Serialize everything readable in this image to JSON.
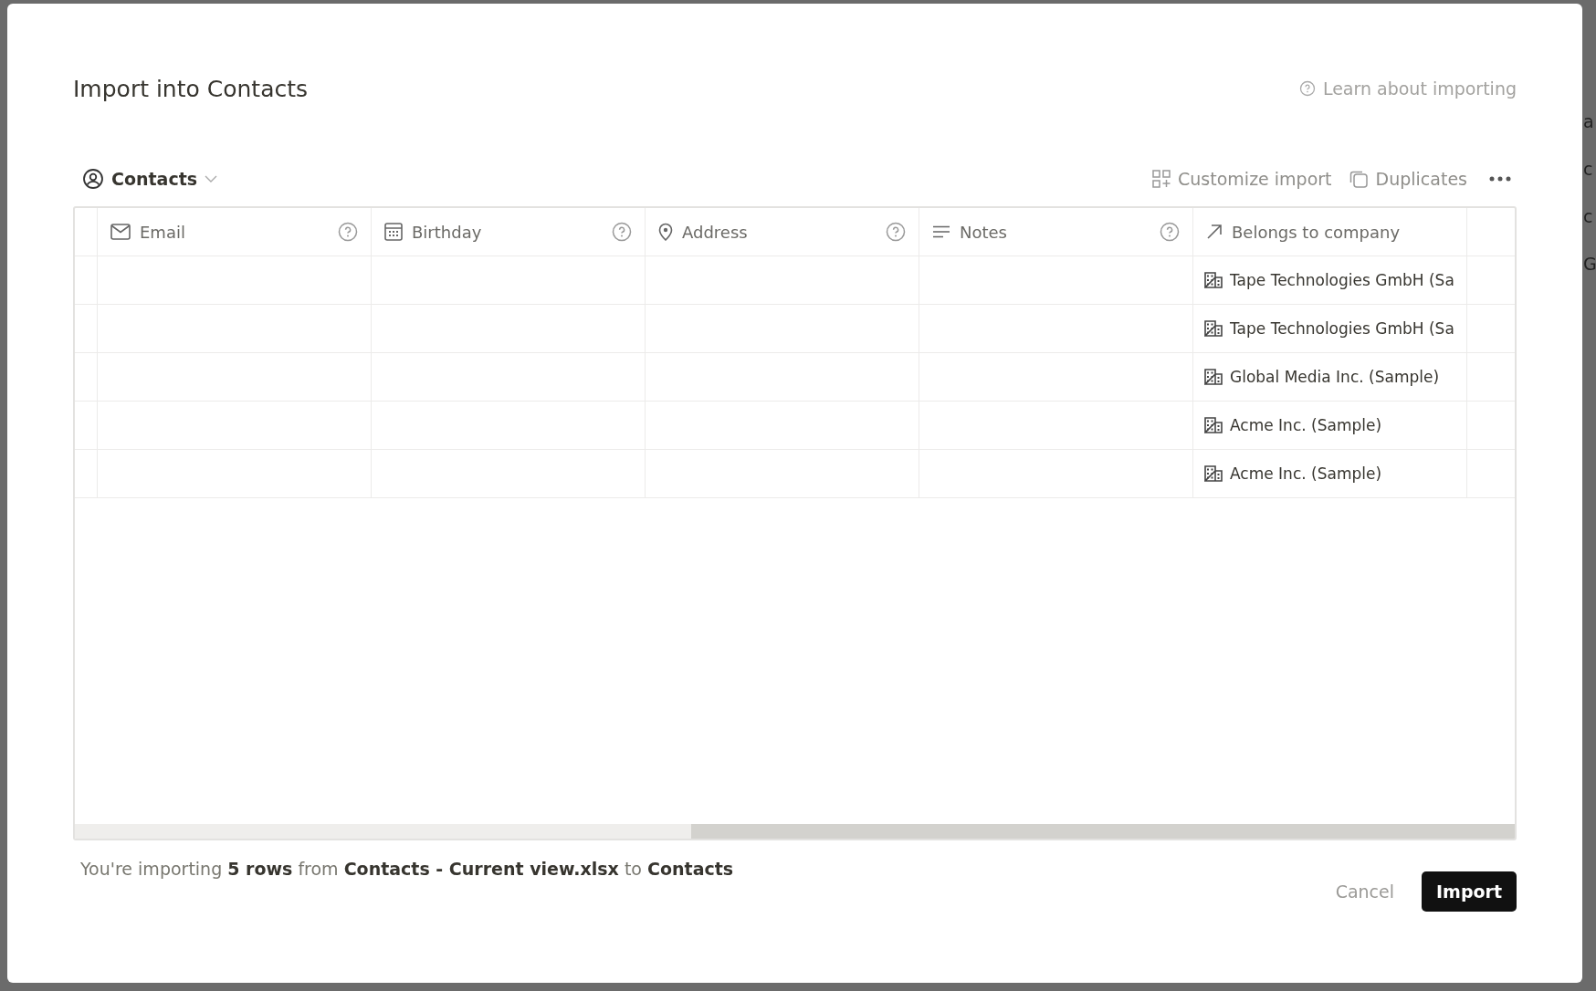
{
  "backdrop": {
    "fragments": [
      "a",
      "c",
      "c",
      "G"
    ]
  },
  "dialog": {
    "title": "Import into Contacts",
    "help_link": "Learn about importing"
  },
  "toolbar": {
    "database": "Contacts",
    "actions": [
      {
        "kind": "customize",
        "label": "Customize import"
      },
      {
        "kind": "duplicates",
        "label": "Duplicates"
      }
    ]
  },
  "table": {
    "columns": [
      {
        "kind": "email",
        "label": "Email",
        "help": true
      },
      {
        "kind": "date",
        "label": "Birthday",
        "help": true
      },
      {
        "kind": "place",
        "label": "Address",
        "help": true
      },
      {
        "kind": "text",
        "label": "Notes",
        "help": true
      },
      {
        "kind": "relation",
        "label": "Belongs to company",
        "help": false
      }
    ],
    "rows": [
      {
        "company": "Tape Technologies GmbH (Sa"
      },
      {
        "company": "Tape Technologies GmbH (Sa"
      },
      {
        "company": "Global Media Inc. (Sample)"
      },
      {
        "company": "Acme Inc. (Sample)"
      },
      {
        "company": "Acme Inc. (Sample)"
      }
    ]
  },
  "footer": {
    "summary": "You're importing **5 rows** from **Contacts - Current view.xlsx** to **Contacts**",
    "cancel": "Cancel",
    "import": "Import"
  }
}
